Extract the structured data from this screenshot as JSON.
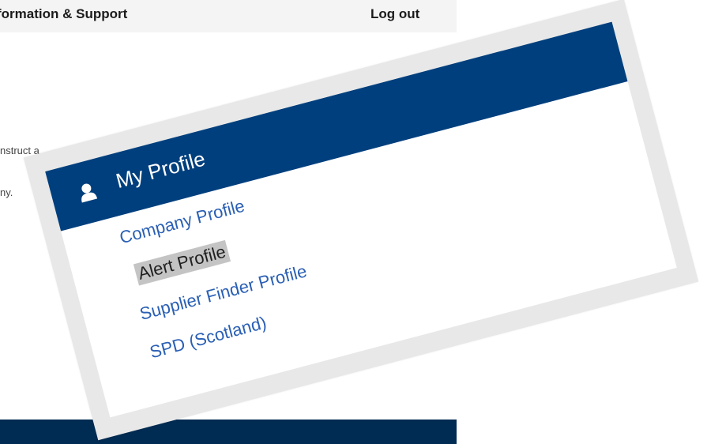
{
  "background_page": {
    "nav": {
      "info_support": "formation & Support",
      "logout": "Log out"
    },
    "text_fragments": [
      "nstruct a",
      "ny."
    ]
  },
  "profile_panel": {
    "title": "My Profile",
    "icon": "user-icon",
    "colors": {
      "header": "#003f7d",
      "link": "#2a5fb4",
      "active_highlight": "#c4c4c4",
      "footer": "#002b52"
    },
    "items": [
      {
        "label": "Company Profile",
        "active": false
      },
      {
        "label": "Alert Profile",
        "active": true
      },
      {
        "label": "Supplier Finder Profile",
        "active": false
      },
      {
        "label": "SPD (Scotland)",
        "active": false
      }
    ]
  }
}
